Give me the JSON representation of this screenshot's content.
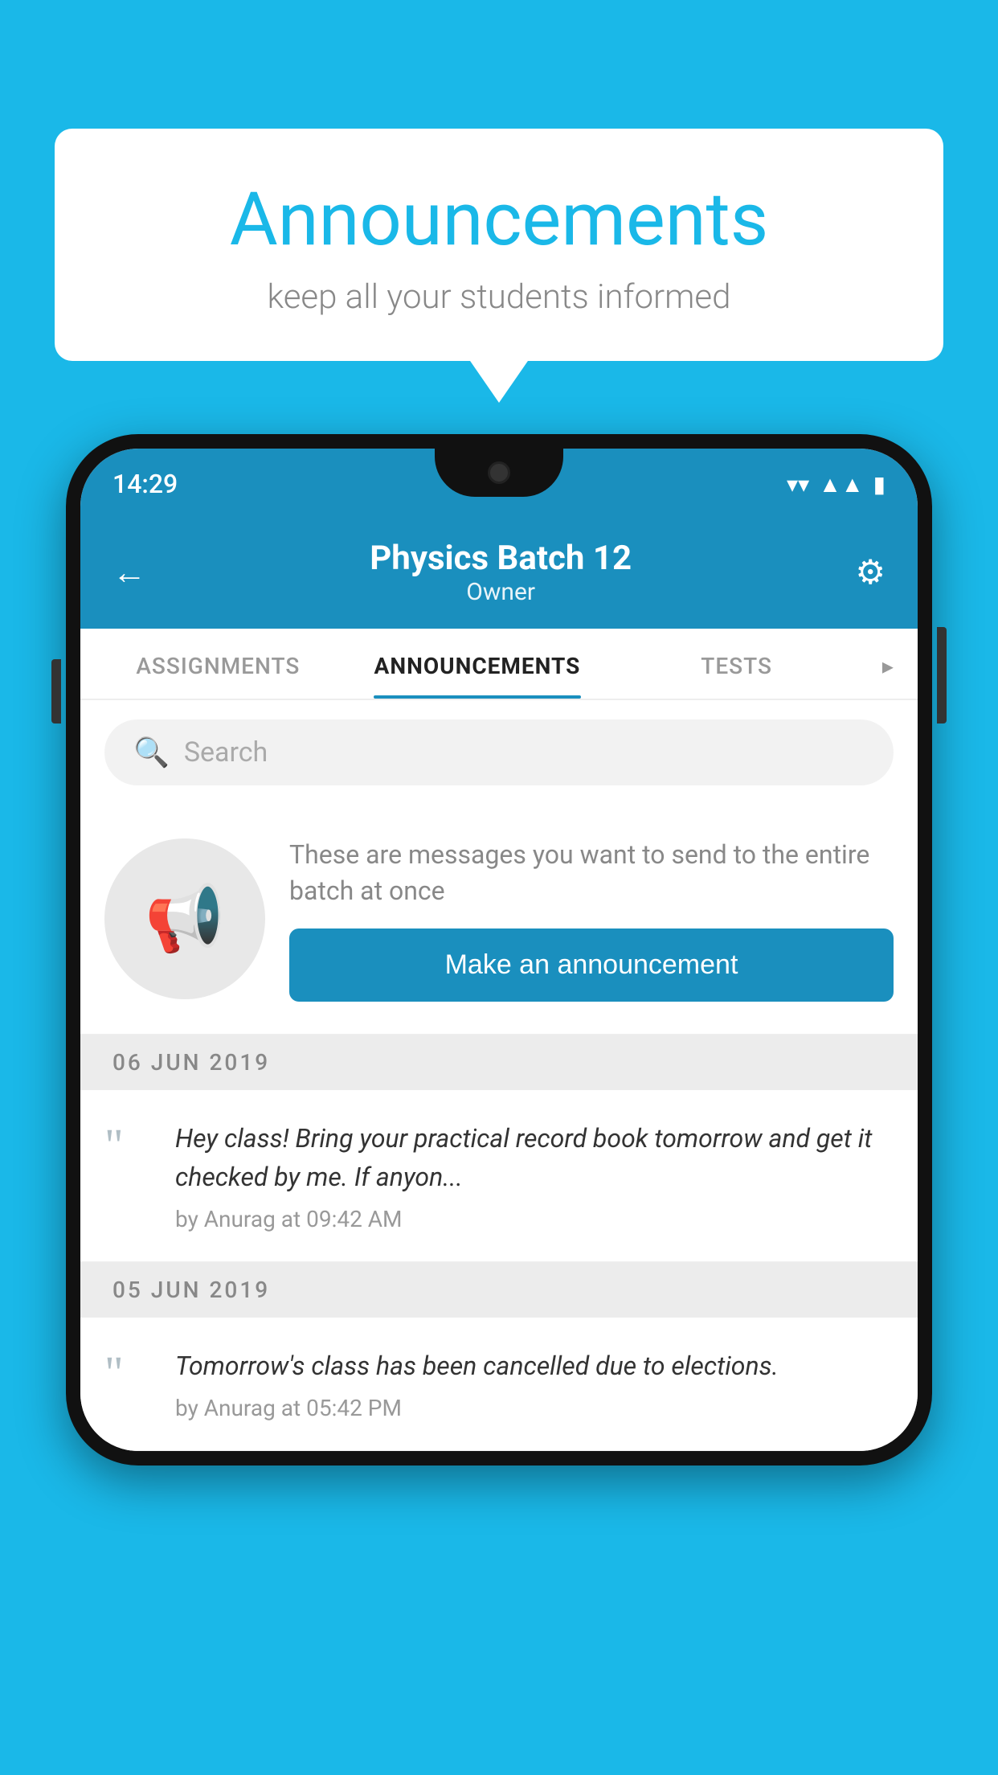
{
  "background_color": "#1ab8e8",
  "speech_bubble": {
    "title": "Announcements",
    "subtitle": "keep all your students informed"
  },
  "phone": {
    "status_bar": {
      "time": "14:29",
      "wifi": "▼",
      "signal": "◀",
      "battery": "▮"
    },
    "header": {
      "back_label": "←",
      "title": "Physics Batch 12",
      "subtitle": "Owner",
      "gear_label": "⚙"
    },
    "tabs": [
      {
        "label": "ASSIGNMENTS",
        "active": false
      },
      {
        "label": "ANNOUNCEMENTS",
        "active": true
      },
      {
        "label": "TESTS",
        "active": false
      }
    ],
    "search": {
      "placeholder": "Search"
    },
    "promo": {
      "description": "These are messages you want to send to the entire batch at once",
      "button_label": "Make an announcement"
    },
    "date_sections": [
      {
        "date": "06  JUN  2019",
        "announcements": [
          {
            "text": "Hey class! Bring your practical record book tomorrow and get it checked by me. If anyon...",
            "meta": "by Anurag at 09:42 AM"
          }
        ]
      },
      {
        "date": "05  JUN  2019",
        "announcements": [
          {
            "text": "Tomorrow's class has been cancelled due to elections.",
            "meta": "by Anurag at 05:42 PM"
          }
        ]
      }
    ]
  }
}
